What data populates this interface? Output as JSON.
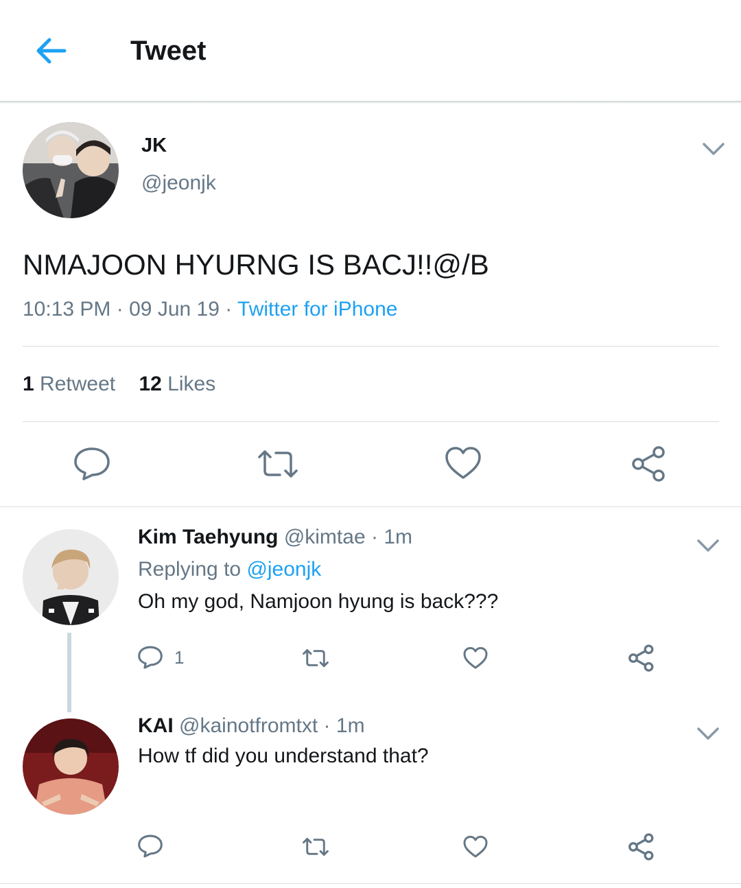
{
  "header": {
    "title": "Tweet"
  },
  "tweet": {
    "display_name": "JK",
    "handle": "@jeonjk",
    "text": "NMAJOON HYURNG IS BACJ!!@/B",
    "time": "10:13 PM",
    "date": "09 Jun 19",
    "separator": "·",
    "source": "Twitter for iPhone",
    "retweet_count": "1",
    "retweet_label": "Retweet",
    "like_count": "12",
    "like_label": "Likes"
  },
  "replies": [
    {
      "display_name": "Kim Taehyung",
      "handle": "@kimtae",
      "time_sep": "·",
      "time": "1m",
      "replying_prefix": "Replying to",
      "replying_handle": "@jeonjk",
      "text": "Oh my god, Namjoon hyung is back???",
      "reply_count": "1"
    },
    {
      "display_name": "KAI",
      "handle": "@kainotfromtxt",
      "time_sep": "·",
      "time": "1m",
      "text": "How tf did you understand that?"
    }
  ],
  "icons": {
    "back": "arrow-left-icon",
    "more": "chevron-down-icon",
    "reply": "speech-bubble-icon",
    "retweet": "retweet-arrows-icon",
    "like": "heart-icon",
    "share": "share-icon"
  },
  "colors": {
    "accent": "#1da1f2",
    "text": "#14171a",
    "secondary": "#657786",
    "divider": "#d7dde2"
  }
}
